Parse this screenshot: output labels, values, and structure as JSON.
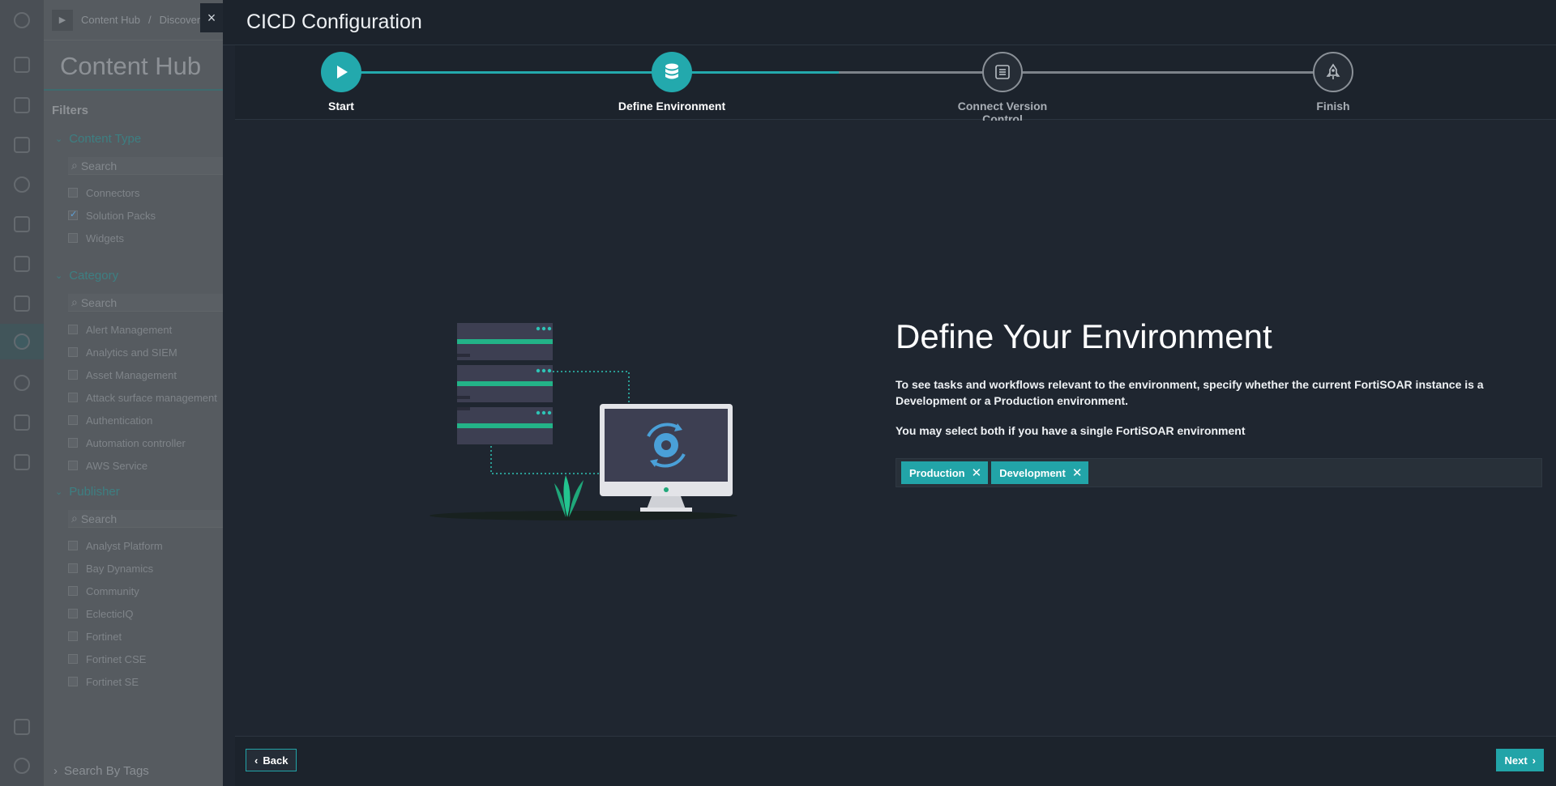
{
  "background": {
    "breadcrumb": [
      "Content Hub",
      "Discover"
    ],
    "hub_title": "Content Hub",
    "filters_label": "Filters",
    "content_type": {
      "heading": "Content Type",
      "search_placeholder": "Search",
      "items": [
        {
          "label": "Connectors",
          "checked": false
        },
        {
          "label": "Solution Packs",
          "checked": true
        },
        {
          "label": "Widgets",
          "checked": false
        }
      ]
    },
    "category": {
      "heading": "Category",
      "search_placeholder": "Search",
      "items": [
        "Alert Management",
        "Analytics and SIEM",
        "Asset Management",
        "Attack surface management",
        "Authentication",
        "Automation controller",
        "AWS Service"
      ]
    },
    "publisher": {
      "heading": "Publisher",
      "search_placeholder": "Search",
      "items": [
        "Analyst Platform",
        "Bay Dynamics",
        "Community",
        "EclecticIQ",
        "Fortinet",
        "Fortinet CSE",
        "Fortinet SE"
      ]
    },
    "search_by_tags": "Search By Tags"
  },
  "modal": {
    "title": "CICD Configuration",
    "close_glyph": "×",
    "steps": [
      {
        "label": "Start",
        "state": "done"
      },
      {
        "label": "Define Environment",
        "state": "current"
      },
      {
        "label": "Connect Version Control",
        "state": "todo"
      },
      {
        "label": "Finish",
        "state": "todo"
      }
    ],
    "heading": "Define Your Environment",
    "description": "To see tasks and workflows relevant to the environment, specify whether the current FortiSOAR instance is a Development or a Production environment.",
    "note": "You may select both if you have a single FortiSOAR environment",
    "selected_environments": [
      "Production",
      "Development"
    ],
    "chip_remove_glyph": "✕",
    "back_label": "Back",
    "next_label": "Next"
  },
  "colors": {
    "accent": "#22a4a8",
    "modal_bg": "#1f2630",
    "background_overlay": "#565b60"
  }
}
